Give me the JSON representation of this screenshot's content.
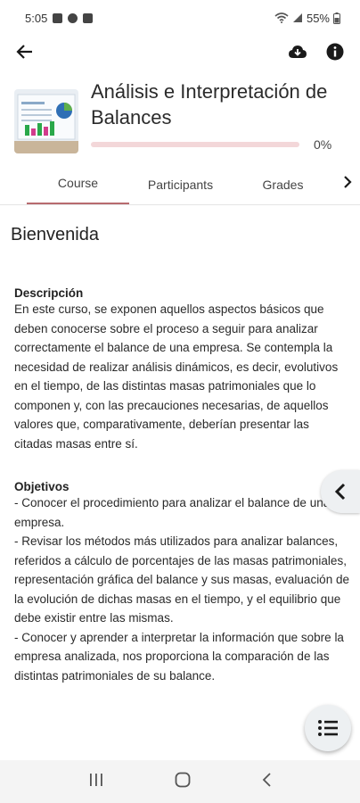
{
  "status": {
    "time": "5:05",
    "battery": "55%"
  },
  "course": {
    "title": "Análisis e Interpretación de Balances",
    "progress_label": "0%",
    "progress_fraction": 0.0
  },
  "tabs": [
    {
      "label": "Course",
      "active": true
    },
    {
      "label": "Participants",
      "active": false
    },
    {
      "label": "Grades",
      "active": false
    }
  ],
  "content": {
    "heading": "Bienvenida",
    "description_title": "Descripción",
    "description_text": "En este curso, se exponen aquellos aspectos básicos que deben conocerse sobre el proceso a seguir para analizar correctamente el balance de una empresa. Se contempla la necesidad de realizar análisis dinámicos, es decir, evolutivos en el tiempo, de las distintas masas patrimoniales que lo componen y, con las precauciones necesarias, de aquellos valores que, comparativamente, deberían presentar las citadas masas entre sí.",
    "objectives_title": "Objetivos",
    "objectives": [
      "- Conocer el procedimiento para analizar el balance de una empresa.",
      "- Revisar los métodos más utilizados para analizar balances, referidos a cálculo de porcentajes de las masas patrimoniales, representación gráfica del balance y sus masas, evaluación de la evolución de dichas masas en el tiempo, y el equilibrio que debe existir entre las mismas.",
      "- Conocer y aprender a interpretar la información que sobre la empresa analizada, nos proporciona la comparación de las distintas patrimoniales de su balance."
    ]
  },
  "colors": {
    "accent": "#c9474f",
    "progress_track": "#f3d7d9"
  },
  "icons": [
    "back-arrow-icon",
    "cloud-download-icon",
    "info-icon",
    "chevron-right-icon",
    "chevron-left-icon",
    "list-icon"
  ]
}
